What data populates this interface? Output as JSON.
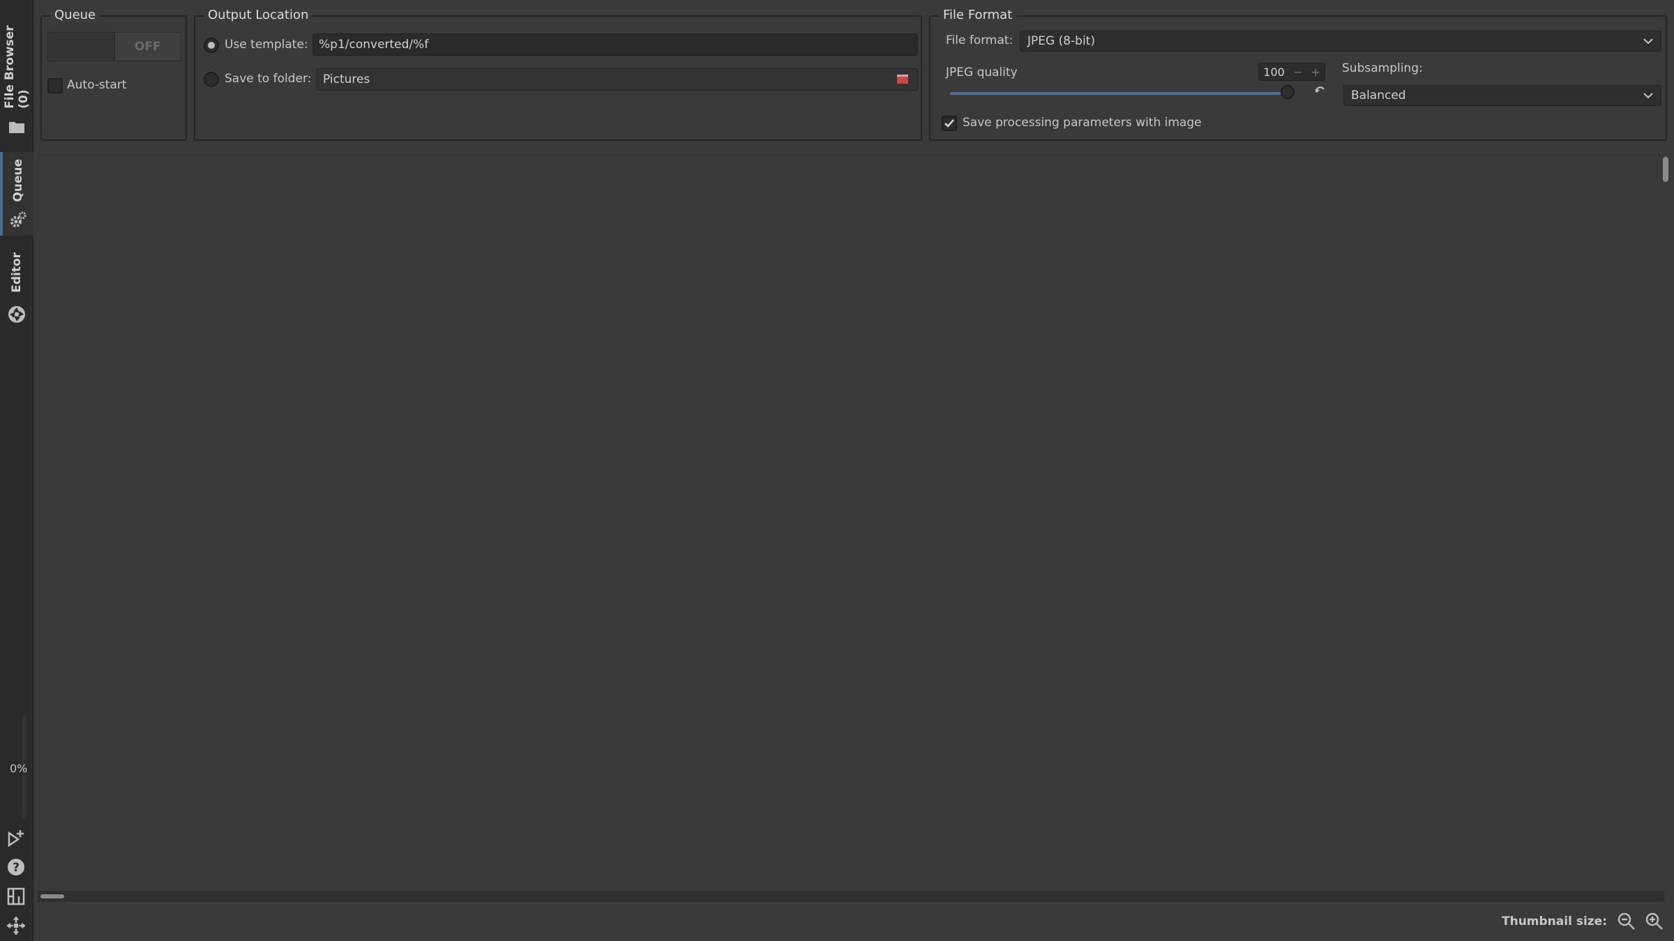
{
  "sidebar": {
    "tabs": [
      {
        "label": "File Browser (0)",
        "icon": "folder-icon"
      },
      {
        "label": "Queue",
        "icon": "gears-icon",
        "active": true
      },
      {
        "label": "Editor",
        "icon": "aperture-icon"
      }
    ],
    "progress_text": "0%",
    "bottom_icons": [
      "add-to-queue-icon",
      "help-icon",
      "toggle-panels-icon",
      "fullscreen-icon"
    ]
  },
  "queue": {
    "title": "Queue",
    "toggle_label": "OFF",
    "autostart_label": "Auto-start"
  },
  "output": {
    "title": "Output Location",
    "use_template_label": "Use template:",
    "template_value": "%p1/converted/%f",
    "save_folder_label": "Save to folder:",
    "folder_value": "Pictures"
  },
  "file_format": {
    "title": "File Format",
    "format_label": "File format:",
    "format_value": "JPEG (8-bit)",
    "quality_label": "JPEG quality",
    "quality_value": "100",
    "quality_fraction": 1.0,
    "subsampling_label": "Subsampling:",
    "subsampling_value": "Balanced",
    "save_params_label": "Save processing parameters with image",
    "save_params_checked": true
  },
  "statusbar": {
    "thumbnail_label": "Thumbnail size:"
  },
  "colors": {
    "accent": "#4d6e93",
    "background": "#3a3a3a",
    "sidebar": "#2a2a2a"
  }
}
